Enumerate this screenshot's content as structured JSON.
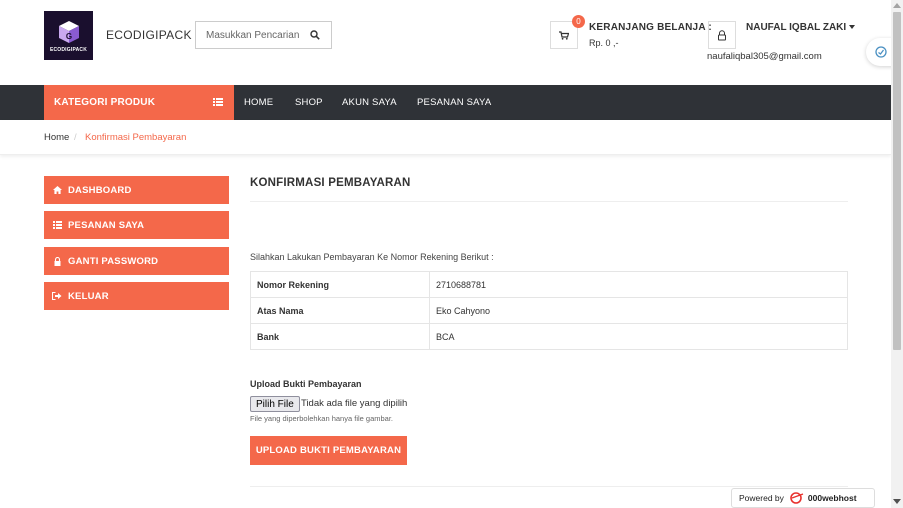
{
  "header": {
    "logo_text": "ECODIGIPACK",
    "brand_name": "ECODIGIPACK",
    "search_placeholder": "Masukkan Pencarian ..",
    "cart": {
      "count": "0",
      "title": "KERANJANG BELANJA :",
      "total": "Rp. 0 ,-"
    },
    "user": {
      "name": "NAUFAL IQBAL ZAKI",
      "email": "naufaliqbal305@gmail.com"
    }
  },
  "nav": {
    "category_label": "KATEGORI PRODUK",
    "items": [
      "HOME",
      "SHOP",
      "AKUN SAYA",
      "PESANAN SAYA"
    ]
  },
  "breadcrumb": {
    "home": "Home",
    "separator": "/",
    "current": "Konfirmasi Pembayaran"
  },
  "sidebar": {
    "items": [
      {
        "label": "DASHBOARD",
        "icon": "home-icon"
      },
      {
        "label": "PESANAN SAYA",
        "icon": "list-icon"
      },
      {
        "label": "GANTI PASSWORD",
        "icon": "lock-icon"
      },
      {
        "label": "KELUAR",
        "icon": "sign-out-icon"
      }
    ]
  },
  "main": {
    "title": "KONFIRMASI PEMBAYARAN",
    "instruction": "Silahkan Lakukan Pembayaran Ke Nomor Rekening Berikut :",
    "account_table": [
      {
        "label": "Nomor Rekening",
        "value": "2710688781"
      },
      {
        "label": "Atas Nama",
        "value": "Eko Cahyono"
      },
      {
        "label": "Bank",
        "value": "BCA"
      }
    ],
    "upload_label": "Upload Bukti Pembayaran",
    "file_button": "Pilih File",
    "file_status": "Tidak ada file yang dipilih",
    "file_help": "File yang diperbolehkan hanya file gambar.",
    "submit_label": "UPLOAD BUKTI PEMBAYARAN"
  },
  "footer_badge": {
    "prefix": "Powered by",
    "brand": "000webhost"
  },
  "colors": {
    "accent": "#f4684a",
    "nav_bg": "#2f3237"
  }
}
